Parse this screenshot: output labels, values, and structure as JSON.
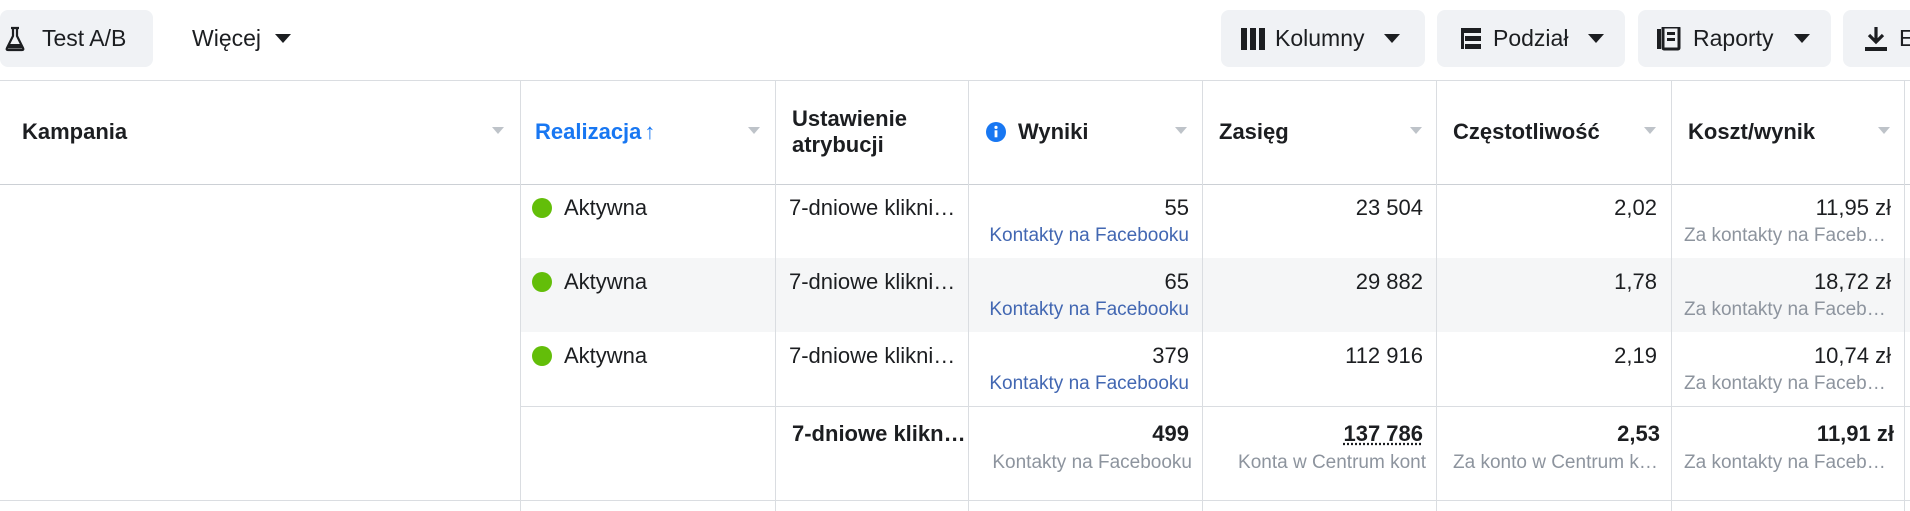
{
  "toolbar": {
    "ab_test_label": "Test A/B",
    "more_label": "Więcej",
    "columns_label": "Kolumny",
    "breakdown_label": "Podział",
    "reports_label": "Raporty",
    "export_label": "E"
  },
  "table": {
    "headers": {
      "campaign": "Kampania",
      "delivery": "Realizacja",
      "delivery_sort_arrow": "↑",
      "attribution_line1": "Ustawienie",
      "attribution_line2": "atrybucji",
      "results": "Wyniki",
      "reach": "Zasięg",
      "frequency": "Częstotliwość",
      "cost_per_result": "Koszt/wynik"
    },
    "rows": [
      {
        "delivery": "Aktywna",
        "attribution": "7-dniowe klikni…",
        "results": "55",
        "results_type": "Kontakty na Facebooku",
        "reach": "23 504",
        "frequency": "2,02",
        "cost": "11,95 zł",
        "cost_type": "Za kontakty na Facebo…"
      },
      {
        "delivery": "Aktywna",
        "attribution": "7-dniowe klikni…",
        "results": "65",
        "results_type": "Kontakty na Facebooku",
        "reach": "29 882",
        "frequency": "1,78",
        "cost": "18,72 zł",
        "cost_type": "Za kontakty na Facebo…"
      },
      {
        "delivery": "Aktywna",
        "attribution": "7-dniowe klikni…",
        "results": "379",
        "results_type": "Kontakty na Facebooku",
        "reach": "112 916",
        "frequency": "2,19",
        "cost": "10,74 zł",
        "cost_type": "Za kontakty na Facebo…"
      }
    ],
    "totals": {
      "attribution": "7-dniowe klikn…",
      "results": "499",
      "results_type": "Kontakty na Facebooku",
      "reach": "137 786",
      "reach_type": "Konta w Centrum kont",
      "frequency": "2,53",
      "frequency_type": "Za konto w Centrum k…",
      "cost": "11,91 zł",
      "cost_type": "Za kontakty na Facebo…"
    }
  },
  "colors": {
    "accent_blue": "#1877f2",
    "link_blue": "#4267b2",
    "active_green": "#63be09",
    "button_gray": "#f0f2f5"
  },
  "icons": {
    "ab_test": "flask-icon",
    "columns": "columns-icon",
    "breakdown": "breakdown-icon",
    "reports": "reports-icon",
    "export": "download-icon",
    "info": "info-icon",
    "dropdown": "caret-down-icon"
  }
}
